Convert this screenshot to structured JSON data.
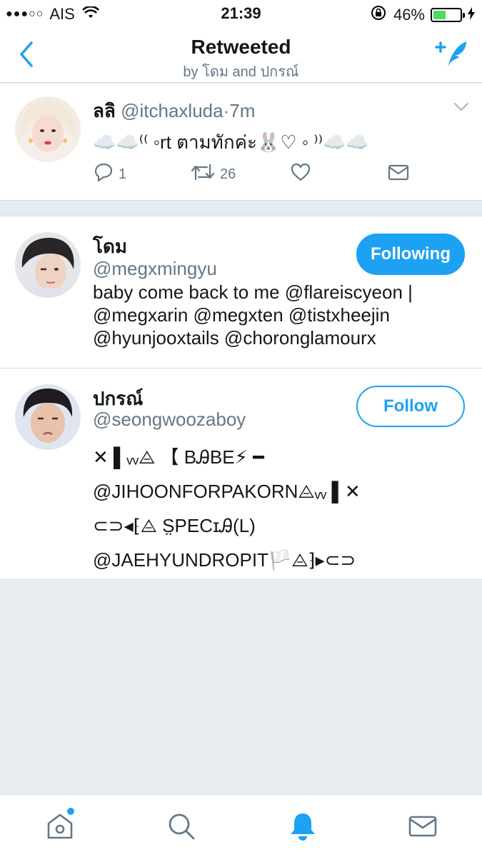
{
  "status_bar": {
    "signal": "●●●○○",
    "carrier": "AIS",
    "time": "21:39",
    "battery": "46%",
    "battery_level": 0.46
  },
  "nav": {
    "title": "Retweeted",
    "subtitle": "by โดม and ปกรณ์"
  },
  "tweet": {
    "name": "ลลิ",
    "handle": "@itchaxluda",
    "dot": "·",
    "time": "7m",
    "text": "☁️☁️⁽⁽ ◦rt ตามทักค่ะ🐰♡ ◦ ⁾⁾☁️☁️",
    "replies": "1",
    "retweets": "26"
  },
  "users": [
    {
      "name": "โดม",
      "handle": "@megxmingyu",
      "bio": "baby come back to me @flareiscyeon | @megxarin @megxten @tistxheejin @hyunjooxtails @choronglamourx",
      "button": "Following"
    },
    {
      "name": "ปกรณ์",
      "handle": "@seongwoozaboy",
      "bio_lines": [
        "✕ ▌ᵥᵥ⨺ 【 BᎯBE⚡ ━",
        "@JIHOONFORPAKORN⨺ᵥᵥ ▌✕",
        "⊂⊃◂⁅⨺ S̤PECɪᎯ(L)",
        "@JAEHYUNDROPIT🏳️⨺⁆▸⊂⊃"
      ],
      "button": "Follow"
    }
  ],
  "colors": {
    "accent": "#1da1f2",
    "secondary_text": "#657786",
    "background": "#e6ecf0"
  },
  "tabs": [
    "home-icon",
    "search-icon",
    "notifications-icon",
    "messages-icon"
  ]
}
